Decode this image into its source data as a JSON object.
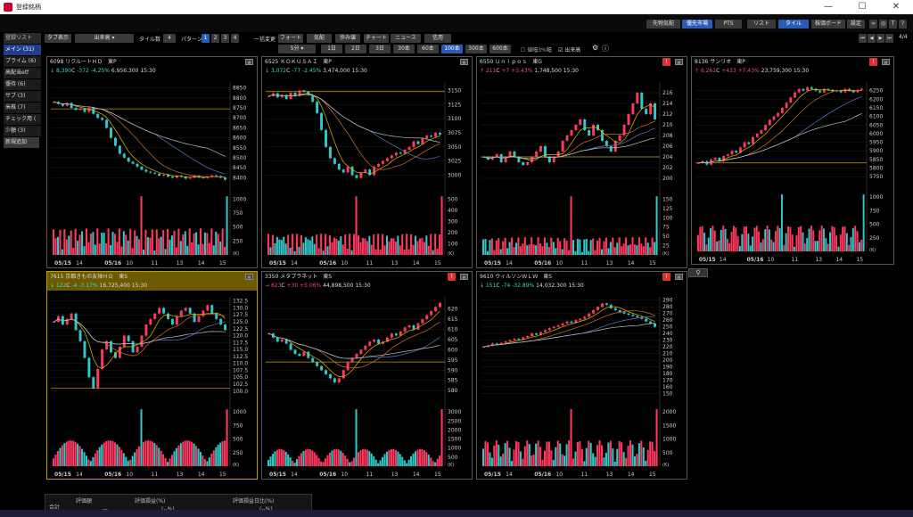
{
  "app": {
    "title": "登録銘柄"
  },
  "menubar": {
    "top_buttons": [
      "先物気配",
      "優先市場",
      "PTS",
      "リスト",
      "タイル",
      "株価ボード",
      "設定"
    ],
    "active_top": [
      "優先市場",
      "タイル"
    ]
  },
  "toolbar": {
    "tab_display": "タブ表示",
    "order_select": "出来高",
    "tile_count_label": "タイル数",
    "tile_count": "4",
    "pattern_label": "パターン",
    "patterns": [
      "1",
      "2",
      "3",
      "4"
    ],
    "bulk_change": "一括変更",
    "row1_buttons": [
      "フォート",
      "気配",
      "歩み値",
      "チャート",
      "ニュース",
      "信用"
    ],
    "interval": "5分",
    "periods": [
      "1日",
      "2日",
      "3日",
      "30本",
      "60本",
      "100本",
      "300本",
      "600本"
    ],
    "active_period": "100本",
    "limit_check": "値幅3%幅",
    "volume_check": "出来高",
    "page_indicator": "4/4"
  },
  "sidebar": {
    "items": [
      "登録リスト",
      "メイン (31)",
      "プライム (6)",
      "高配当etf",
      "優待 (6)",
      "サブ (3)",
      "米株 (7)",
      "チェック用 (",
      "少額 (3)",
      "新規追加"
    ],
    "active": 1
  },
  "panels": [
    {
      "code": "6098",
      "name": "リクルートＨＤ",
      "market": "東P",
      "dir": "↓",
      "price": "8,390",
      "suffix": "C",
      "change": "-372",
      "pct": "-4.25%",
      "volume": "6,956,300",
      "time": "15:30",
      "trend": "dn",
      "highlight": false,
      "warn": false,
      "y_ticks": [
        "8850",
        "8800",
        "8750",
        "8700",
        "8650",
        "8600",
        "8550",
        "8500",
        "8450",
        "8400"
      ],
      "vol_ticks": [
        "1000",
        "750",
        "500",
        "250"
      ],
      "x_ticks": [
        "05/15",
        "14",
        "05/16",
        "10",
        "11",
        "13",
        "14",
        "15"
      ],
      "closes": [
        8780,
        8770,
        8760,
        8775,
        8750,
        8740,
        8745,
        8730,
        8750,
        8720,
        8700,
        8690,
        8650,
        8600,
        8560,
        8520,
        8500,
        8480,
        8470,
        8455,
        8440,
        8430,
        8425,
        8420,
        8410,
        8415,
        8405,
        8400,
        8410,
        8405,
        8395,
        8400,
        8410,
        8402,
        8398,
        8404,
        8412,
        8408,
        8400,
        8390
      ],
      "ymin": 8370,
      "ymax": 8880,
      "ref": 8745
    },
    {
      "code": "6525",
      "name": "ＫＯＫＵＳＡＩ",
      "market": "東P",
      "dir": "↓",
      "price": "3,072",
      "suffix": "C",
      "change": "-77",
      "pct": "-2.45%",
      "volume": "3,474,000",
      "time": "15:30",
      "trend": "dn",
      "highlight": false,
      "warn": false,
      "y_ticks": [
        "3150",
        "3125",
        "3100",
        "3075",
        "3050",
        "3025",
        "3000"
      ],
      "vol_ticks": [
        "500",
        "400",
        "300",
        "200",
        "100"
      ],
      "x_ticks": [
        "05/15",
        "14",
        "05/16",
        "10",
        "11",
        "13",
        "14",
        "15"
      ],
      "closes": [
        3140,
        3145,
        3138,
        3142,
        3135,
        3146,
        3140,
        3150,
        3148,
        3142,
        3130,
        3110,
        3080,
        3050,
        3030,
        3020,
        3010,
        3005,
        3015,
        3000,
        2995,
        3005,
        3010,
        3000,
        3015,
        3020,
        3025,
        3030,
        3035,
        3040,
        3038,
        3045,
        3050,
        3060,
        3055,
        3065,
        3070,
        3068,
        3075,
        3072
      ],
      "ymin": 2985,
      "ymax": 3165,
      "ref": 3148
    },
    {
      "code": "6550",
      "name": "Ｕｎｉｐｏｓ",
      "market": "東G",
      "dir": "↑",
      "price": "211",
      "suffix": "C",
      "change": "+7",
      "pct": "+3.43%",
      "volume": "1,748,500",
      "time": "15:30",
      "trend": "up",
      "highlight": false,
      "warn": true,
      "y_ticks": [
        "216",
        "214",
        "212",
        "210",
        "208",
        "206",
        "204",
        "202",
        "200"
      ],
      "vol_ticks": [
        "150",
        "125",
        "100",
        "75",
        "50",
        "25"
      ],
      "x_ticks": [
        "05/15",
        "14",
        "05/16",
        "10",
        "11",
        "13",
        "14",
        "15"
      ],
      "closes": [
        204,
        203.5,
        204,
        204.5,
        203,
        204,
        205,
        204,
        203,
        202.5,
        203,
        204,
        205,
        206,
        204,
        203,
        204,
        205,
        207,
        208,
        209,
        210,
        211,
        209,
        208,
        210,
        209,
        207,
        206,
        205,
        207,
        208,
        210,
        212,
        214,
        216,
        213,
        212,
        214,
        211
      ],
      "ymin": 199,
      "ymax": 218,
      "ref": 204
    },
    {
      "code": "8136",
      "name": "サンリオ",
      "market": "東P",
      "dir": "↑",
      "price": "6,261",
      "suffix": "C",
      "change": "+433",
      "pct": "+7.43%",
      "volume": "23,759,300",
      "time": "15:30",
      "trend": "up",
      "highlight": false,
      "warn": true,
      "y_ticks": [
        "6250",
        "6200",
        "6150",
        "6100",
        "6050",
        "6000",
        "5950",
        "5900",
        "5850",
        "5800",
        "5750"
      ],
      "vol_ticks": [
        "1000",
        "750",
        "500",
        "250"
      ],
      "x_ticks": [
        "05/15",
        "14",
        "05/16",
        "10",
        "11",
        "13",
        "14",
        "15"
      ],
      "closes": [
        5830,
        5840,
        5820,
        5850,
        5860,
        5840,
        5870,
        5880,
        5900,
        5890,
        5920,
        5950,
        5940,
        5980,
        6000,
        6020,
        6050,
        6080,
        6100,
        6120,
        6150,
        6180,
        6210,
        6240,
        6260,
        6250,
        6270,
        6260,
        6250,
        6240,
        6260,
        6255,
        6245,
        6250,
        6240,
        6260,
        6250,
        6240,
        6255,
        6261
      ],
      "ymin": 5720,
      "ymax": 6300,
      "ref": 5830
    },
    {
      "code": "7615",
      "name": "京都きもの友禅ＨＤ",
      "market": "東S",
      "dir": "↓",
      "price": "122",
      "suffix": "C",
      "change": "-4",
      "pct": "-3.17%",
      "volume": "16,725,400",
      "time": "15:30",
      "trend": "dn",
      "highlight": true,
      "warn": false,
      "y_ticks": [
        "132.5",
        "130.0",
        "127.5",
        "125.0",
        "122.5",
        "120.0",
        "117.5",
        "115.0",
        "112.5",
        "110.0",
        "107.5",
        "105.0",
        "102.5",
        "100.0"
      ],
      "vol_ticks": [
        "1000",
        "750",
        "500",
        "250"
      ],
      "x_ticks": [
        "05/15",
        "14",
        "05/16",
        "10",
        "11",
        "13",
        "14",
        "15"
      ],
      "closes": [
        125,
        127,
        124,
        126,
        128,
        122,
        118,
        112,
        105,
        101,
        108,
        115,
        118,
        114,
        112,
        116,
        120,
        118,
        114,
        116,
        120,
        124,
        126,
        128,
        130,
        128,
        126,
        124,
        127,
        129,
        130,
        128,
        125,
        127,
        129,
        131,
        128,
        126,
        124,
        122
      ],
      "ymin": 98,
      "ymax": 134,
      "ref": 101
    },
    {
      "code": "3350",
      "name": "メタプラネット",
      "market": "東S",
      "dir": "→",
      "price": "623",
      "suffix": "C",
      "change": "+30",
      "pct": "+5.06%",
      "volume": "44,898,500",
      "time": "15:30",
      "trend": "up",
      "highlight": false,
      "warn": true,
      "y_ticks": [
        "620",
        "615",
        "610",
        "605",
        "600",
        "595",
        "590",
        "585",
        "580"
      ],
      "vol_ticks": [
        "3000",
        "2500",
        "2000",
        "1500",
        "1000",
        "500"
      ],
      "x_ticks": [
        "05/15",
        "14",
        "05/16",
        "10",
        "11",
        "13",
        "14",
        "15"
      ],
      "closes": [
        608,
        606,
        604,
        605,
        603,
        600,
        598,
        597,
        599,
        596,
        594,
        592,
        590,
        588,
        586,
        584,
        586,
        590,
        594,
        596,
        598,
        600,
        602,
        604,
        605,
        603,
        604,
        606,
        608,
        607,
        609,
        611,
        612,
        610,
        613,
        615,
        617,
        619,
        621,
        623
      ],
      "ymin": 577,
      "ymax": 626,
      "ref": 594
    },
    {
      "code": "9610",
      "name": "ウィルソンＷＬＷ",
      "market": "東S",
      "dir": "↓",
      "price": "151",
      "suffix": "C",
      "change": "-74",
      "pct": "-32.89%",
      "volume": "14,032,300",
      "time": "15:30",
      "trend": "dn",
      "highlight": false,
      "warn": true,
      "y_ticks": [
        "290",
        "280",
        "270",
        "260",
        "250",
        "240",
        "230",
        "220",
        "210",
        "200",
        "190",
        "180",
        "170",
        "160",
        "150"
      ],
      "vol_ticks": [
        "2000",
        "1500",
        "1000",
        "500"
      ],
      "x_ticks": [
        "05/15",
        "14",
        "05/16",
        "10",
        "11",
        "13",
        "14",
        "15"
      ],
      "closes": [
        220,
        222,
        225,
        224,
        226,
        228,
        230,
        232,
        231,
        234,
        236,
        240,
        238,
        242,
        245,
        248,
        250,
        252,
        255,
        258,
        256,
        260,
        262,
        265,
        270,
        275,
        280,
        285,
        283,
        278,
        275,
        272,
        270,
        268,
        266,
        264,
        262,
        258,
        255,
        250
      ],
      "ymin": 145,
      "ymax": 295,
      "ref": 0
    }
  ],
  "bottom": {
    "total_label": "合計",
    "cols": [
      "評価額",
      "評価損益(%)",
      "評価損益日比(%)"
    ],
    "values": [
      "—",
      "(--%)",
      "(--%)"
    ]
  }
}
